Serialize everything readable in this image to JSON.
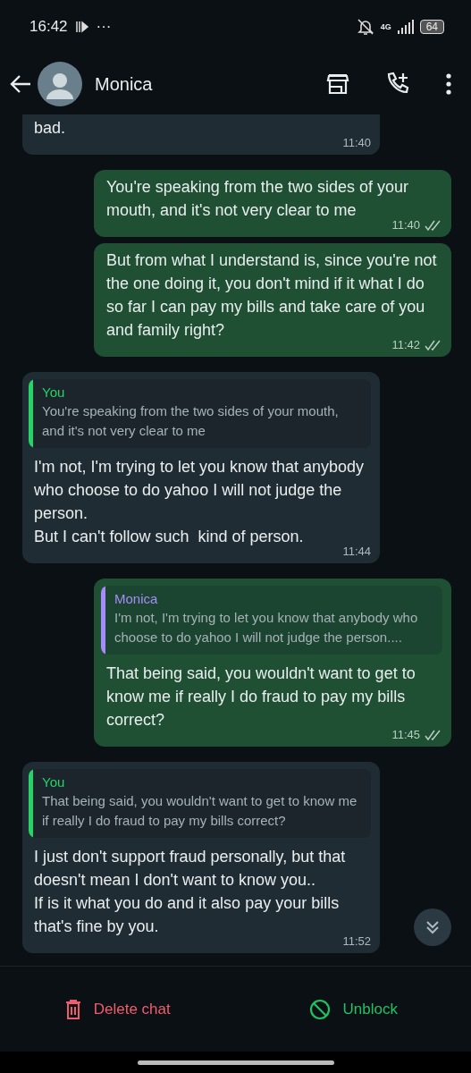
{
  "status_bar": {
    "time": "16:42",
    "more": "···",
    "network": "4G",
    "battery": "64"
  },
  "header": {
    "contact_name": "Monica"
  },
  "messages": [
    {
      "kind": "in",
      "text": "bad.",
      "time": "11:40"
    },
    {
      "kind": "out",
      "text": "You're speaking from the two sides of your mouth, and it's not very clear to me",
      "time": "11:40"
    },
    {
      "kind": "out",
      "text": "But from what I understand is, since you're not the one doing it, you don't mind if it what I do so far I can pay my bills and take care of you and family right?",
      "time": "11:42"
    },
    {
      "kind": "in",
      "quote": {
        "author": "You",
        "color": "#25d366",
        "text": "You're speaking from the two sides of your mouth, and it's not very clear to me"
      },
      "text": "I'm not, I'm trying to let you know that anybody who choose to do yahoo I will not judge the person.\nBut I can't follow such  kind of person.",
      "time": "11:44"
    },
    {
      "kind": "out",
      "quote": {
        "author": "Monica",
        "color": "#a78bfa",
        "text": "I'm not, I'm trying to let you know that anybody who choose to do yahoo I will not judge the person...."
      },
      "text": "That being said, you wouldn't want to get to know me if really I do fraud to pay my bills correct?",
      "time": "11:45"
    },
    {
      "kind": "in",
      "quote": {
        "author": "You",
        "color": "#25d366",
        "text": "That being said, you wouldn't want to get to know me if really I do fraud to pay my bills correct?"
      },
      "text": "I just don't support fraud personally, but that doesn't mean I don't want to know you..\nIf is it what you do and it also pay your bills that's fine by you.",
      "time": "11:52"
    }
  ],
  "actions": [
    {
      "kind": "delete",
      "label": "Delete chat"
    },
    {
      "kind": "unblock",
      "label": "Unblock"
    }
  ]
}
